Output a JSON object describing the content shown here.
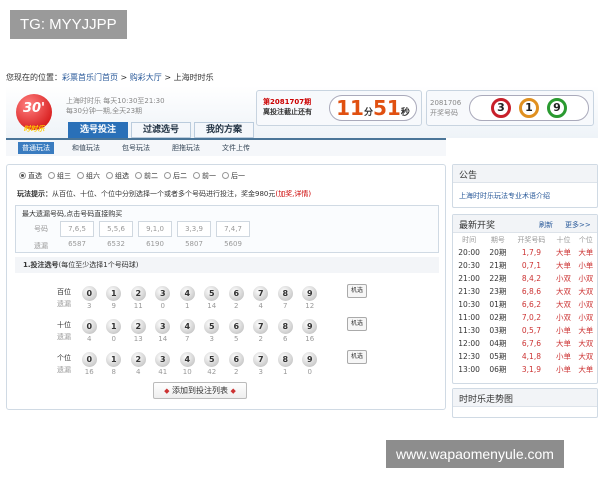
{
  "watermarks": {
    "top": "TG: MYYJJPP",
    "bottom": "www.wapaomenyule.com"
  },
  "breadcrumb": {
    "prefix": "您现在的位置：",
    "links": [
      "彩票首乐门首页",
      "购彩大厅"
    ],
    "sep": " > ",
    "current": "上海时时乐"
  },
  "logo": {
    "text": "30'",
    "sub": "时时乐"
  },
  "intro": {
    "line1": "上海时时乐 每天10:30至21:30",
    "line2": "每30分钟一期,全天23期"
  },
  "tabs": [
    "选号投注",
    "过滤选号",
    "我的方案"
  ],
  "issue": {
    "number": "第2081707期",
    "label": "离投注截止还有",
    "minutes": "11",
    "min_unit": "分",
    "seconds": "51",
    "sec_unit": "秒"
  },
  "last_draw": {
    "number": "2081706",
    "label": "开奖号码",
    "balls": [
      {
        "n": "3",
        "color": "#c8202a"
      },
      {
        "n": "1",
        "color": "#e09020"
      },
      {
        "n": "9",
        "color": "#2a9a30"
      }
    ]
  },
  "subnav": [
    "普通玩法",
    "和值玩法",
    "包号玩法",
    "胆拖玩法",
    "文件上传"
  ],
  "play_types": [
    {
      "label": "直选",
      "checked": true
    },
    {
      "label": "组三"
    },
    {
      "label": "组六"
    },
    {
      "label": "组选"
    },
    {
      "label": "前二"
    },
    {
      "label": "后二"
    },
    {
      "label": "前一"
    },
    {
      "label": "后一"
    }
  ],
  "tip": {
    "label": "玩法提示：",
    "text": "从百位、十位、个位中分别选择一个或者多个号码进行投注，奖金980元",
    "link": "(加奖,详情)"
  },
  "hot": {
    "title": "最大遗漏号码,点击号码直接购买",
    "code_label": "号码",
    "miss_label": "遗漏",
    "items": [
      {
        "c": "7,6,5",
        "m": "6587"
      },
      {
        "c": "5,5,6",
        "m": "6532"
      },
      {
        "c": "9,1,0",
        "m": "6190"
      },
      {
        "c": "3,3,9",
        "m": "5807"
      },
      {
        "c": "7,4,7",
        "m": "5609"
      }
    ]
  },
  "section": {
    "title": "1.投注选号",
    "hint": "(每位至少选择1个号码球)"
  },
  "miss_label": "遗漏",
  "pick_label": "机选",
  "positions": [
    {
      "name": "百位",
      "miss": [
        "3",
        "9",
        "11",
        "0",
        "1",
        "14",
        "2",
        "4",
        "7",
        "12"
      ]
    },
    {
      "name": "十位",
      "miss": [
        "4",
        "0",
        "13",
        "14",
        "7",
        "3",
        "5",
        "2",
        "6",
        "16"
      ]
    },
    {
      "name": "个位",
      "miss": [
        "16",
        "8",
        "4",
        "41",
        "10",
        "42",
        "2",
        "3",
        "1",
        "0"
      ]
    }
  ],
  "digits": [
    "0",
    "1",
    "2",
    "3",
    "4",
    "5",
    "6",
    "7",
    "8",
    "9"
  ],
  "add_button": "添加到投注列表",
  "notice": {
    "title": "公告",
    "link": "上海时时乐玩法专业术语介绍"
  },
  "latest": {
    "title": "最新开奖",
    "refresh": "刷新",
    "more": "更多>>",
    "headers": [
      "时间",
      "期号",
      "开奖号码",
      "十位",
      "个位"
    ],
    "rows": [
      [
        "20:00",
        "20期",
        "1,7,9",
        "大单",
        "大单"
      ],
      [
        "20:30",
        "21期",
        "0,7,1",
        "大单",
        "小单"
      ],
      [
        "21:00",
        "22期",
        "8,4,2",
        "小双",
        "小双"
      ],
      [
        "21:30",
        "23期",
        "6,8,6",
        "大双",
        "大双"
      ],
      [
        "10:30",
        "01期",
        "6,6,2",
        "大双",
        "小双"
      ],
      [
        "11:00",
        "02期",
        "7,0,2",
        "小双",
        "小双"
      ],
      [
        "11:30",
        "03期",
        "0,5,7",
        "小单",
        "大单"
      ],
      [
        "12:00",
        "04期",
        "6,7,6",
        "大单",
        "大双"
      ],
      [
        "12:30",
        "05期",
        "4,1,8",
        "小单",
        "大双"
      ],
      [
        "13:00",
        "06期",
        "3,1,9",
        "小单",
        "大单"
      ]
    ]
  },
  "trend": {
    "title": "时时乐走势图"
  }
}
